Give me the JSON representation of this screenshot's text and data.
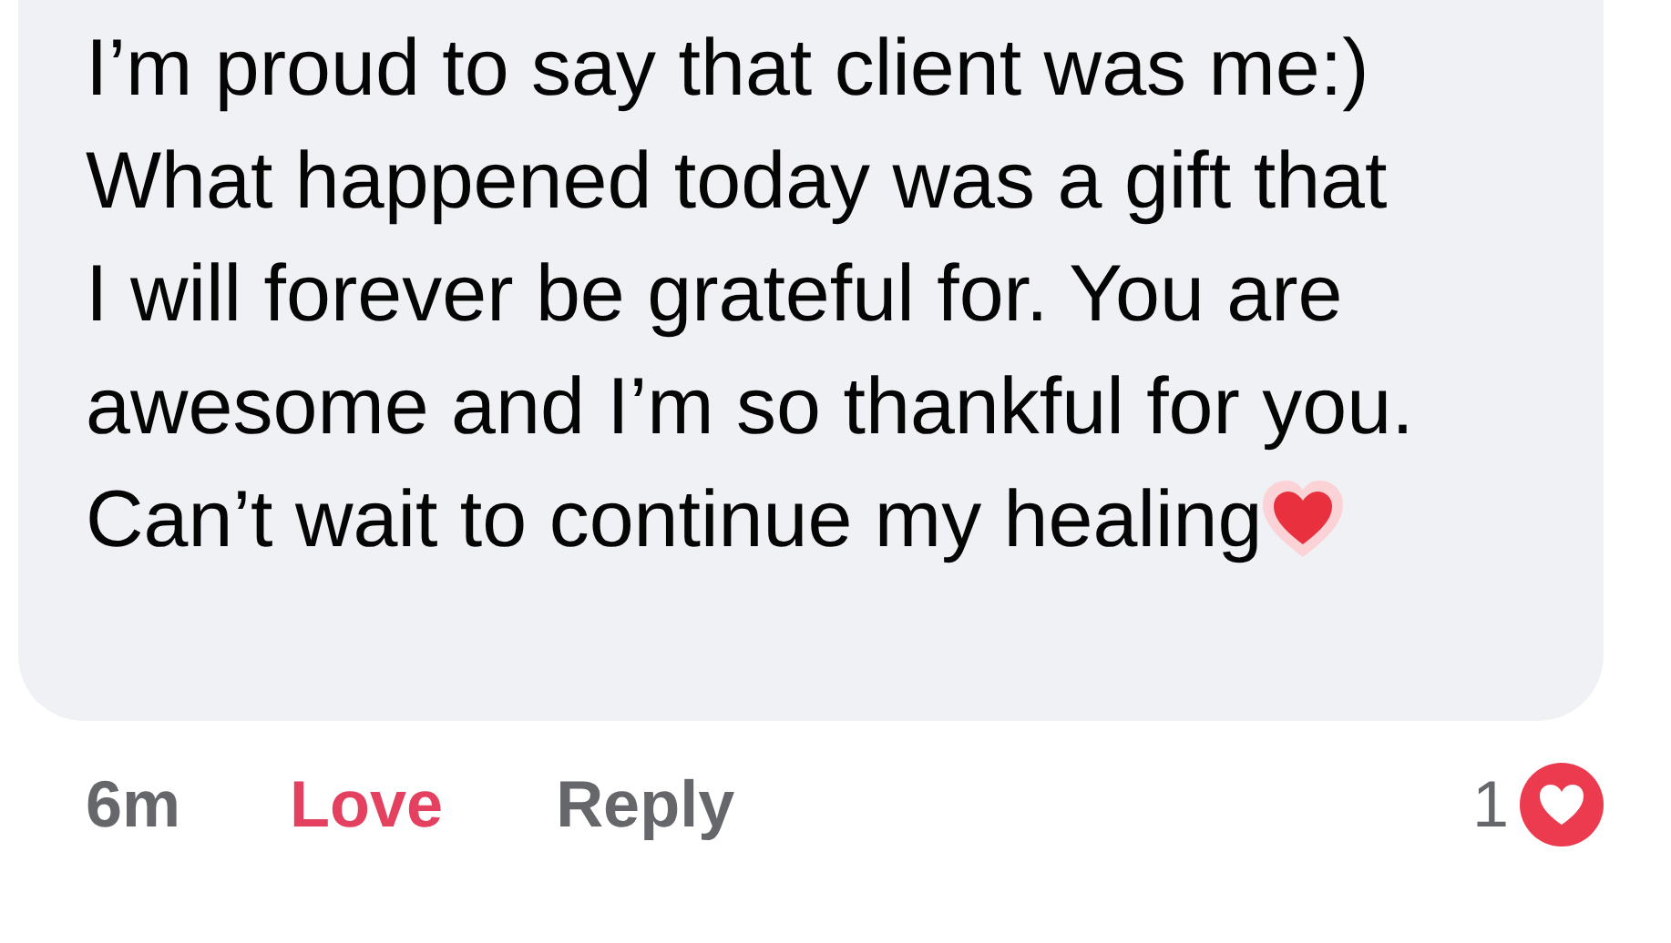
{
  "comment": {
    "lines": [
      "I’m proud to say that client was me:)",
      "What happened today was a gift that",
      "I will forever be grateful for. You are",
      "awesome and I’m so thankful for you.",
      "Can’t wait to continue my healing"
    ]
  },
  "actions": {
    "time": "6m",
    "love": {
      "label": "Love",
      "reacted": true
    },
    "reply": "Reply",
    "reaction_count": "1"
  }
}
